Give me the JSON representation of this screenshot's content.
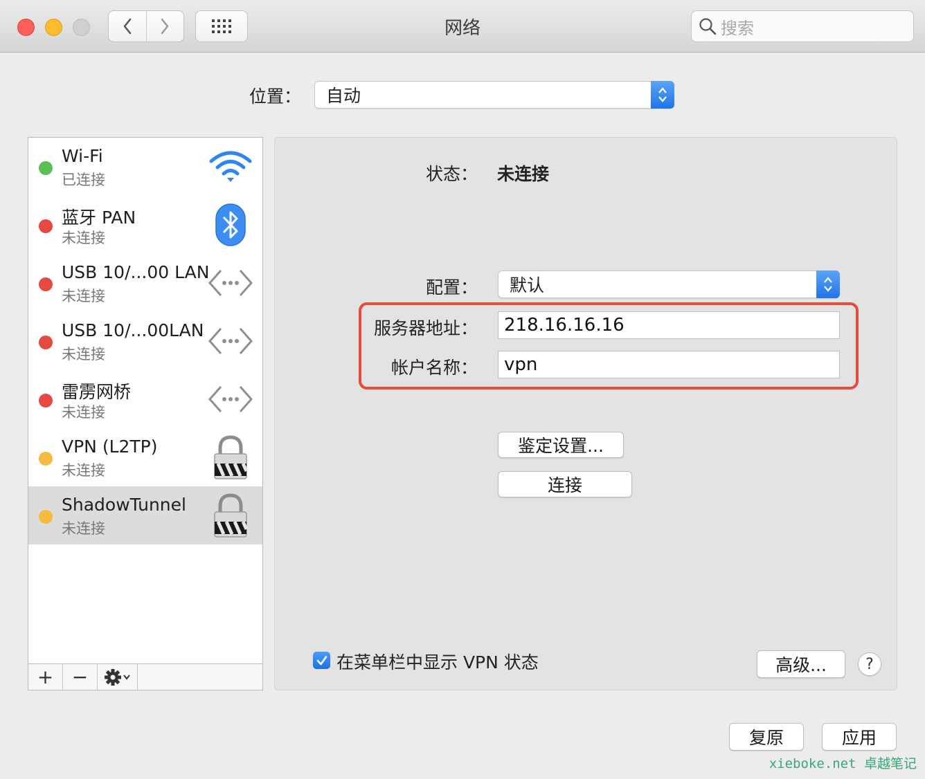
{
  "window": {
    "title": "网络"
  },
  "search": {
    "placeholder": "搜索"
  },
  "location": {
    "label": "位置：",
    "value": "自动"
  },
  "services": [
    {
      "name": "Wi-Fi",
      "status": "已连接",
      "dot_color": "#5cbf55",
      "icon": "wifi-icon"
    },
    {
      "name": "蓝牙 PAN",
      "status": "未连接",
      "dot_color": "#e5493f",
      "icon": "bluetooth-icon"
    },
    {
      "name": "USB 10/...00 LAN",
      "status": "未连接",
      "dot_color": "#e5493f",
      "icon": "ethernet-icon"
    },
    {
      "name": "USB 10/...00LAN",
      "status": "未连接",
      "dot_color": "#e5493f",
      "icon": "ethernet-icon"
    },
    {
      "name": "雷雳网桥",
      "status": "未连接",
      "dot_color": "#e5493f",
      "icon": "ethernet-icon"
    },
    {
      "name": "VPN (L2TP)",
      "status": "未连接",
      "dot_color": "#f6bb3e",
      "icon": "vpn-lock-icon"
    },
    {
      "name": "ShadowTunnel",
      "status": "未连接",
      "dot_color": "#f6bb3e",
      "icon": "vpn-lock-icon"
    }
  ],
  "sidebar_toolbar": {
    "add": "+",
    "remove": "−"
  },
  "detail": {
    "status_label": "状态：",
    "status_value": "未连接",
    "config_label": "配置：",
    "config_value": "默认",
    "server_label": "服务器地址：",
    "server_value": "218.16.16.16",
    "account_label": "帐户名称：",
    "account_value": "vpn",
    "auth_button": "鉴定设置...",
    "connect_button": "连接",
    "show_vpn_label": "在菜单栏中显示 VPN 状态",
    "show_vpn_checked": true,
    "advanced_button": "高级...",
    "help_button": "?"
  },
  "footer": {
    "revert_button": "复原",
    "apply_button": "应用"
  },
  "watermark": "xieboke.net 卓越笔记",
  "colors": {
    "accent": "#1f74e8",
    "highlight_border": "#e84a3c"
  }
}
